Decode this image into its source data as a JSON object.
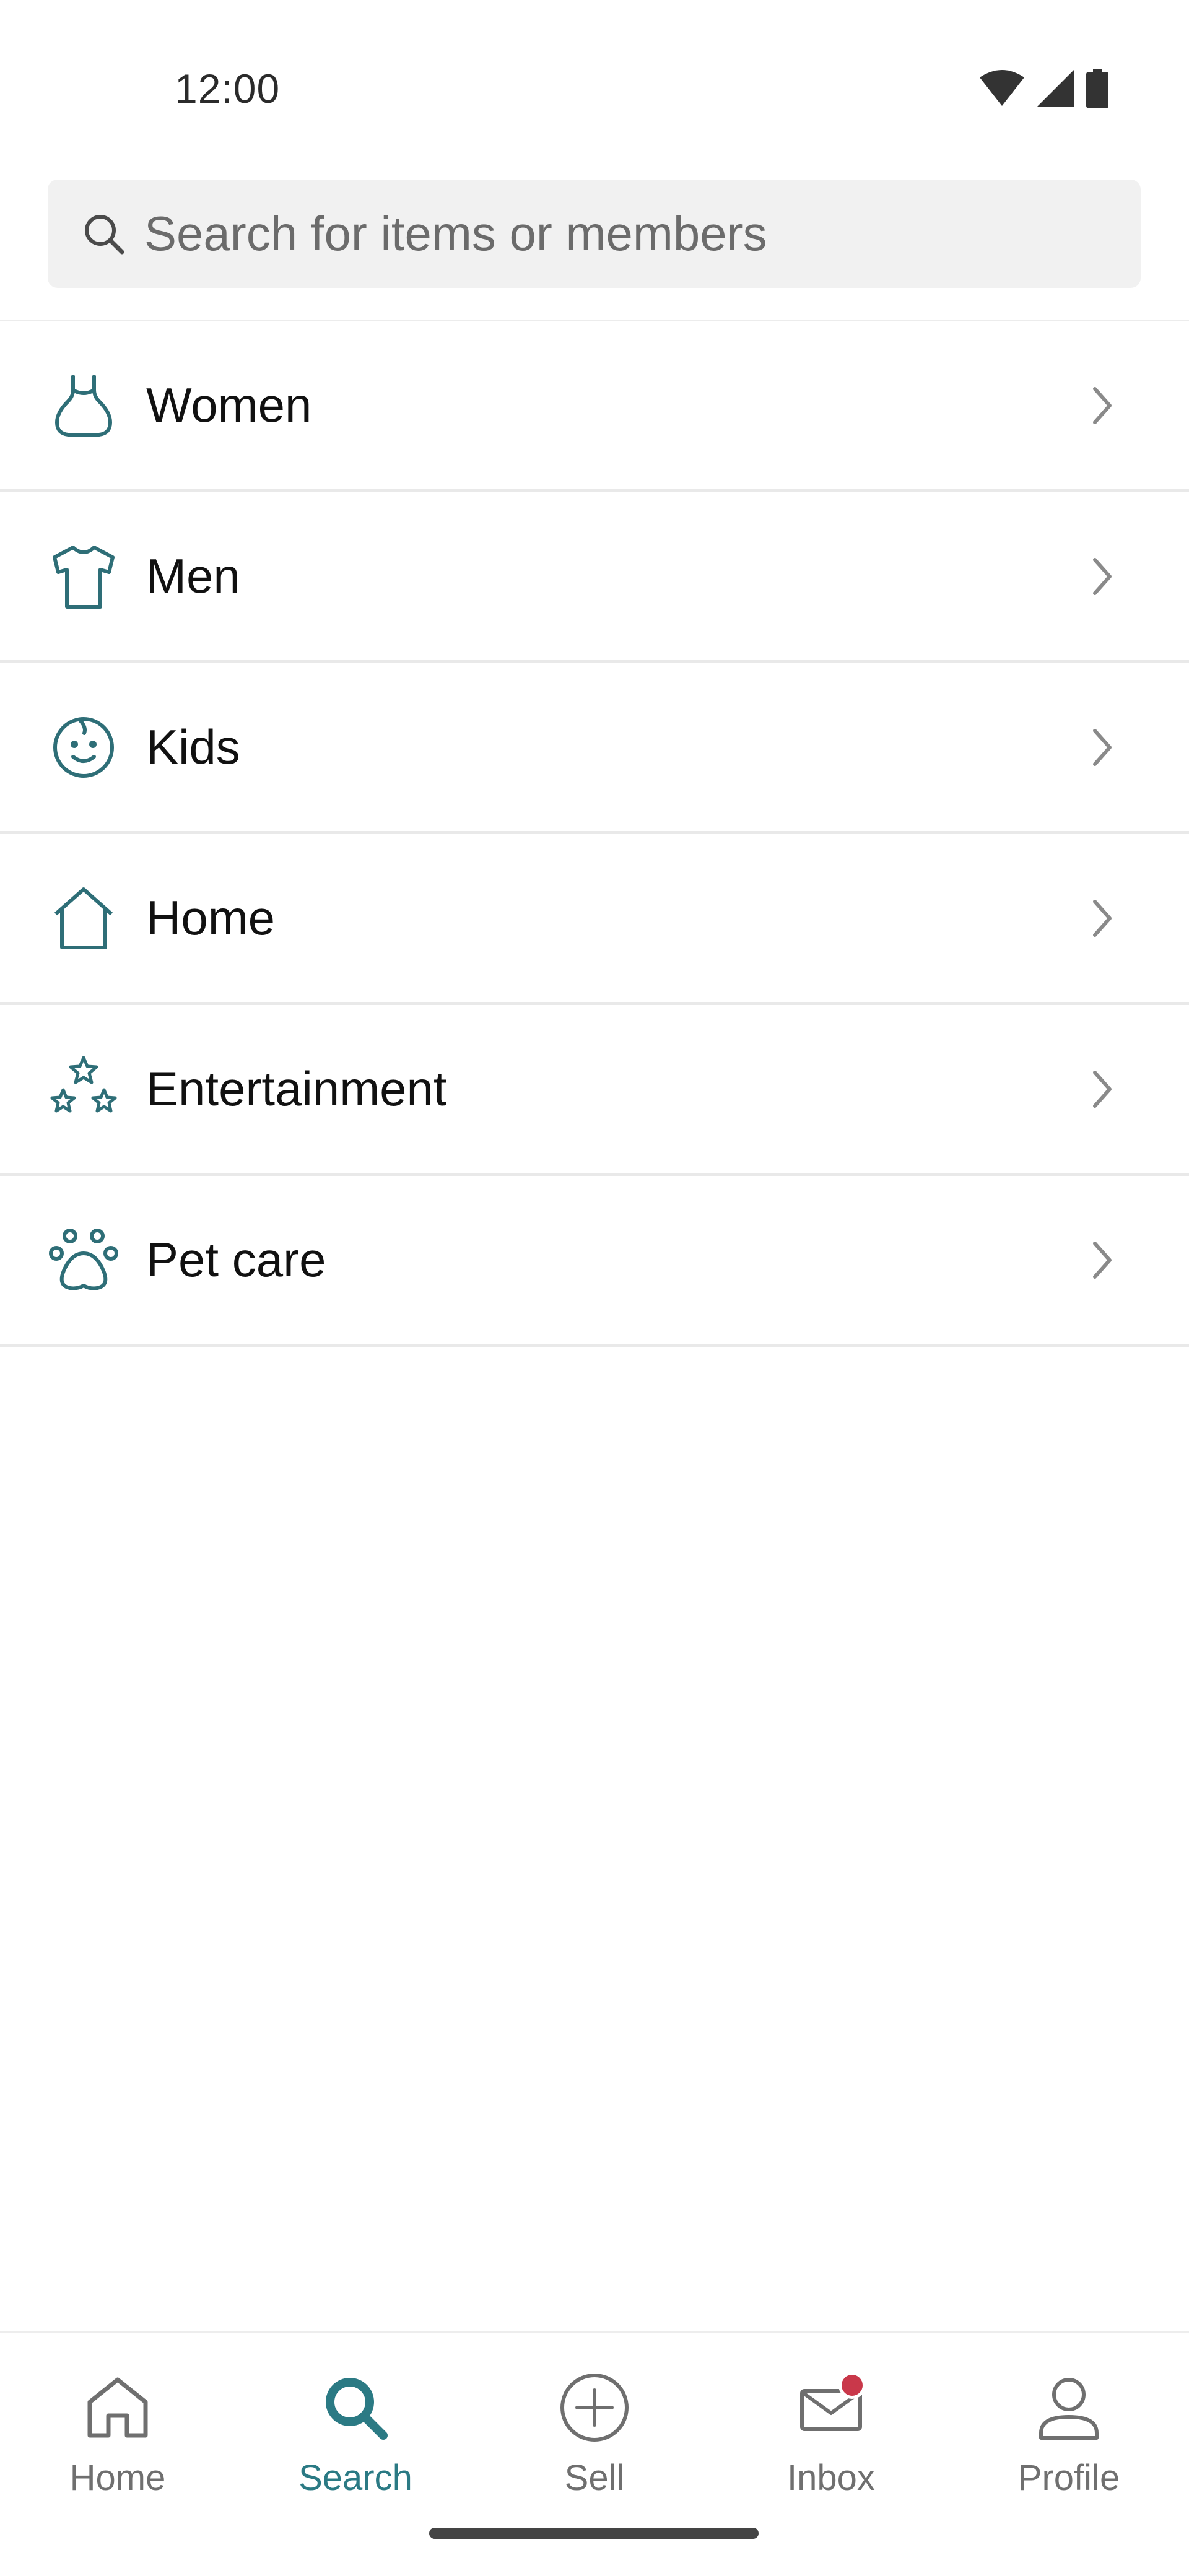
{
  "status_bar": {
    "time": "12:00"
  },
  "search": {
    "placeholder": "Search for items or members",
    "icon": "search-icon"
  },
  "categories": [
    {
      "label": "Women",
      "icon": "dress-icon"
    },
    {
      "label": "Men",
      "icon": "tshirt-icon"
    },
    {
      "label": "Kids",
      "icon": "baby-face-icon"
    },
    {
      "label": "Home",
      "icon": "house-icon"
    },
    {
      "label": "Entertainment",
      "icon": "stars-icon"
    },
    {
      "label": "Pet care",
      "icon": "paw-icon"
    }
  ],
  "bottom_nav": {
    "items": [
      {
        "label": "Home",
        "icon": "home-icon",
        "active": false
      },
      {
        "label": "Search",
        "icon": "search-icon",
        "active": true
      },
      {
        "label": "Sell",
        "icon": "plus-circle-icon",
        "active": false
      },
      {
        "label": "Inbox",
        "icon": "mail-icon",
        "active": false,
        "badge": true
      },
      {
        "label": "Profile",
        "icon": "person-icon",
        "active": false
      }
    ]
  },
  "colors": {
    "accent": "#2b7a84",
    "icon_teal": "#2e6e77",
    "badge": "#c9384a",
    "search_bg": "#f1f1f1",
    "divider": "#e9e9e9"
  }
}
